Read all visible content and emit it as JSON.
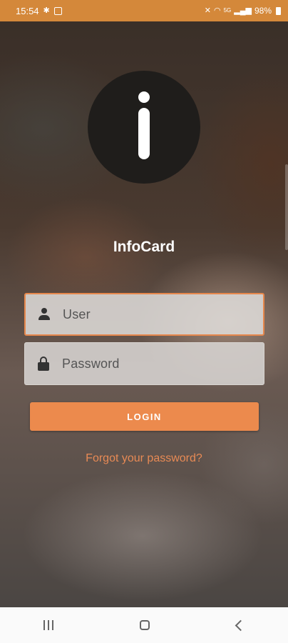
{
  "status_bar": {
    "time": "15:54",
    "battery": "98%",
    "network": "5G"
  },
  "app": {
    "title": "InfoCard",
    "logo_icon": "info-i-icon"
  },
  "form": {
    "user_placeholder": "User",
    "password_placeholder": "Password",
    "login_label": "LOGIN",
    "forgot_label": "Forgot your password?"
  },
  "colors": {
    "accent": "#ec8a4d",
    "status_bar": "#d4883a",
    "logo_circle": "#1f1d1b"
  },
  "nav": {
    "recents": "recents-icon",
    "home": "home-icon",
    "back": "back-icon"
  }
}
